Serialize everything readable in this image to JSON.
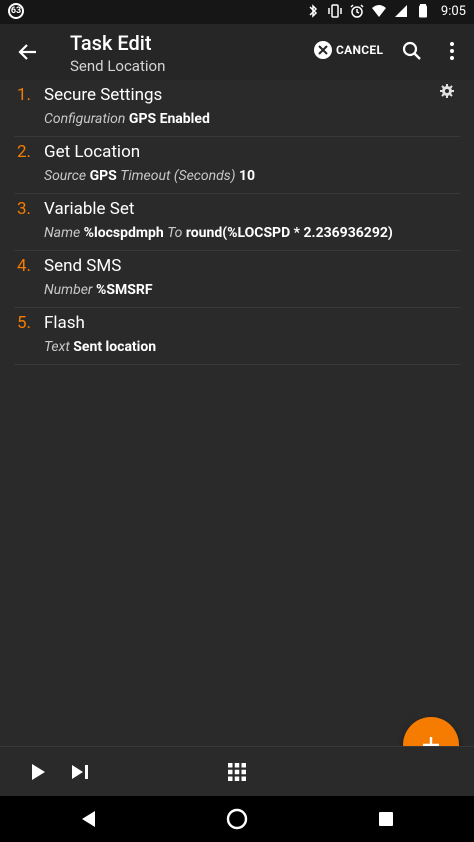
{
  "status_bar": {
    "notification_badge": "63",
    "time": "9:05",
    "icons": [
      "bluetooth-icon",
      "vibrate-icon",
      "alarm-icon",
      "wifi-icon",
      "signal-icon",
      "battery-icon"
    ]
  },
  "app_bar": {
    "title": "Task Edit",
    "subtitle": "Send Location",
    "cancel_label": "CANCEL"
  },
  "actions": [
    {
      "number": "1.",
      "name": "Secure Settings",
      "args": [
        {
          "label": "Configuration",
          "value": "GPS Enabled"
        }
      ],
      "has_settings_icon": true
    },
    {
      "number": "2.",
      "name": "Get Location",
      "args": [
        {
          "label": "Source",
          "value": "GPS"
        },
        {
          "label": "Timeout (Seconds)",
          "value": "10"
        }
      ]
    },
    {
      "number": "3.",
      "name": "Variable Set",
      "args": [
        {
          "label": "Name",
          "value": "%locspdmph"
        },
        {
          "label": "To",
          "value": "round(%LOCSPD * 2.236936292)"
        }
      ]
    },
    {
      "number": "4.",
      "name": "Send SMS",
      "args": [
        {
          "label": "Number",
          "value": "%SMSRF"
        }
      ]
    },
    {
      "number": "5.",
      "name": "Flash",
      "args": [
        {
          "label": "Text",
          "value": "Sent location"
        }
      ]
    }
  ],
  "colors": {
    "accent": "#f57c00",
    "background": "#2a2a2a",
    "app_bar": "#262626"
  }
}
